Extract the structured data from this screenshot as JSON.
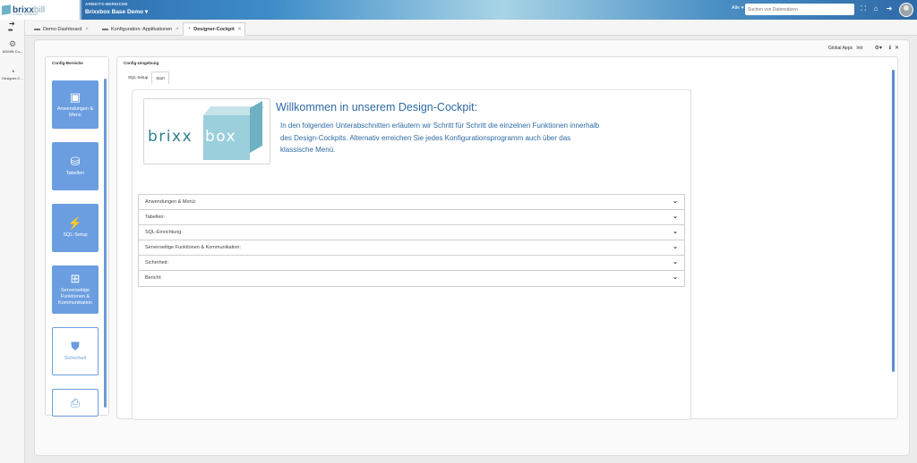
{
  "header": {
    "logo_word": "brixx",
    "logo_word_suffix": "bill",
    "logo_sub": "Cloud Software",
    "workspace_label": "ARBEITS-BEREICHE",
    "workspace_name": "Brixxbox Base Demo ▾",
    "filter_label": "Alle ▾",
    "search_placeholder": "Suchen von Datensätzen"
  },
  "rail": {
    "items": [
      {
        "label": "ADMIN Co..."
      },
      {
        "label": "Designer-C..."
      }
    ]
  },
  "tabs": [
    {
      "label": "Demo-Dashboard"
    },
    {
      "label": "Konfiguration: Applikationen"
    },
    {
      "label": "Designer-Cockpit"
    }
  ],
  "toolbar": {
    "global_apps": "Global Apps",
    "init": "Init"
  },
  "config_bereiche": {
    "title": "Config-Bereiche",
    "tiles": [
      {
        "label": "Anwendungen & Menü"
      },
      {
        "label": "Tabellen"
      },
      {
        "label": "SQL-Setup"
      },
      {
        "label": "Serverseitige Funktionen & Kommunikation"
      },
      {
        "label": "Sicherheit"
      },
      {
        "label": ""
      }
    ]
  },
  "config_umgebung": {
    "title": "Config-Umgebung",
    "subtabs": [
      {
        "label": "SQL-Setup"
      },
      {
        "label": "Start"
      }
    ],
    "logo_text_1": "brixx",
    "logo_text_2": "box",
    "welcome_title": "Willkommen in unserem Design-Cockpit:",
    "welcome_text": "In den folgenden Unterabschnitten erläutern wir Schritt für Schritt die einzelnen Funktionen innerhalb des Design-Cockpits. Alternativ erreichen Sie jedes Konfigurationsprogramm auch über das klassische Menü.",
    "accordion": [
      {
        "label": "Anwendungen & Menü:"
      },
      {
        "label": "Tabellen:"
      },
      {
        "label": "SQL-Einrichtung:"
      },
      {
        "label": "Serverseitige Funktionen & Kommunikation:"
      },
      {
        "label": "Sicherheit:"
      },
      {
        "label": "Bericht:"
      }
    ]
  },
  "colors": {
    "accent": "#6b9ee0",
    "title_blue": "#2f6aa4",
    "header_blue": "#3d8cc8"
  }
}
